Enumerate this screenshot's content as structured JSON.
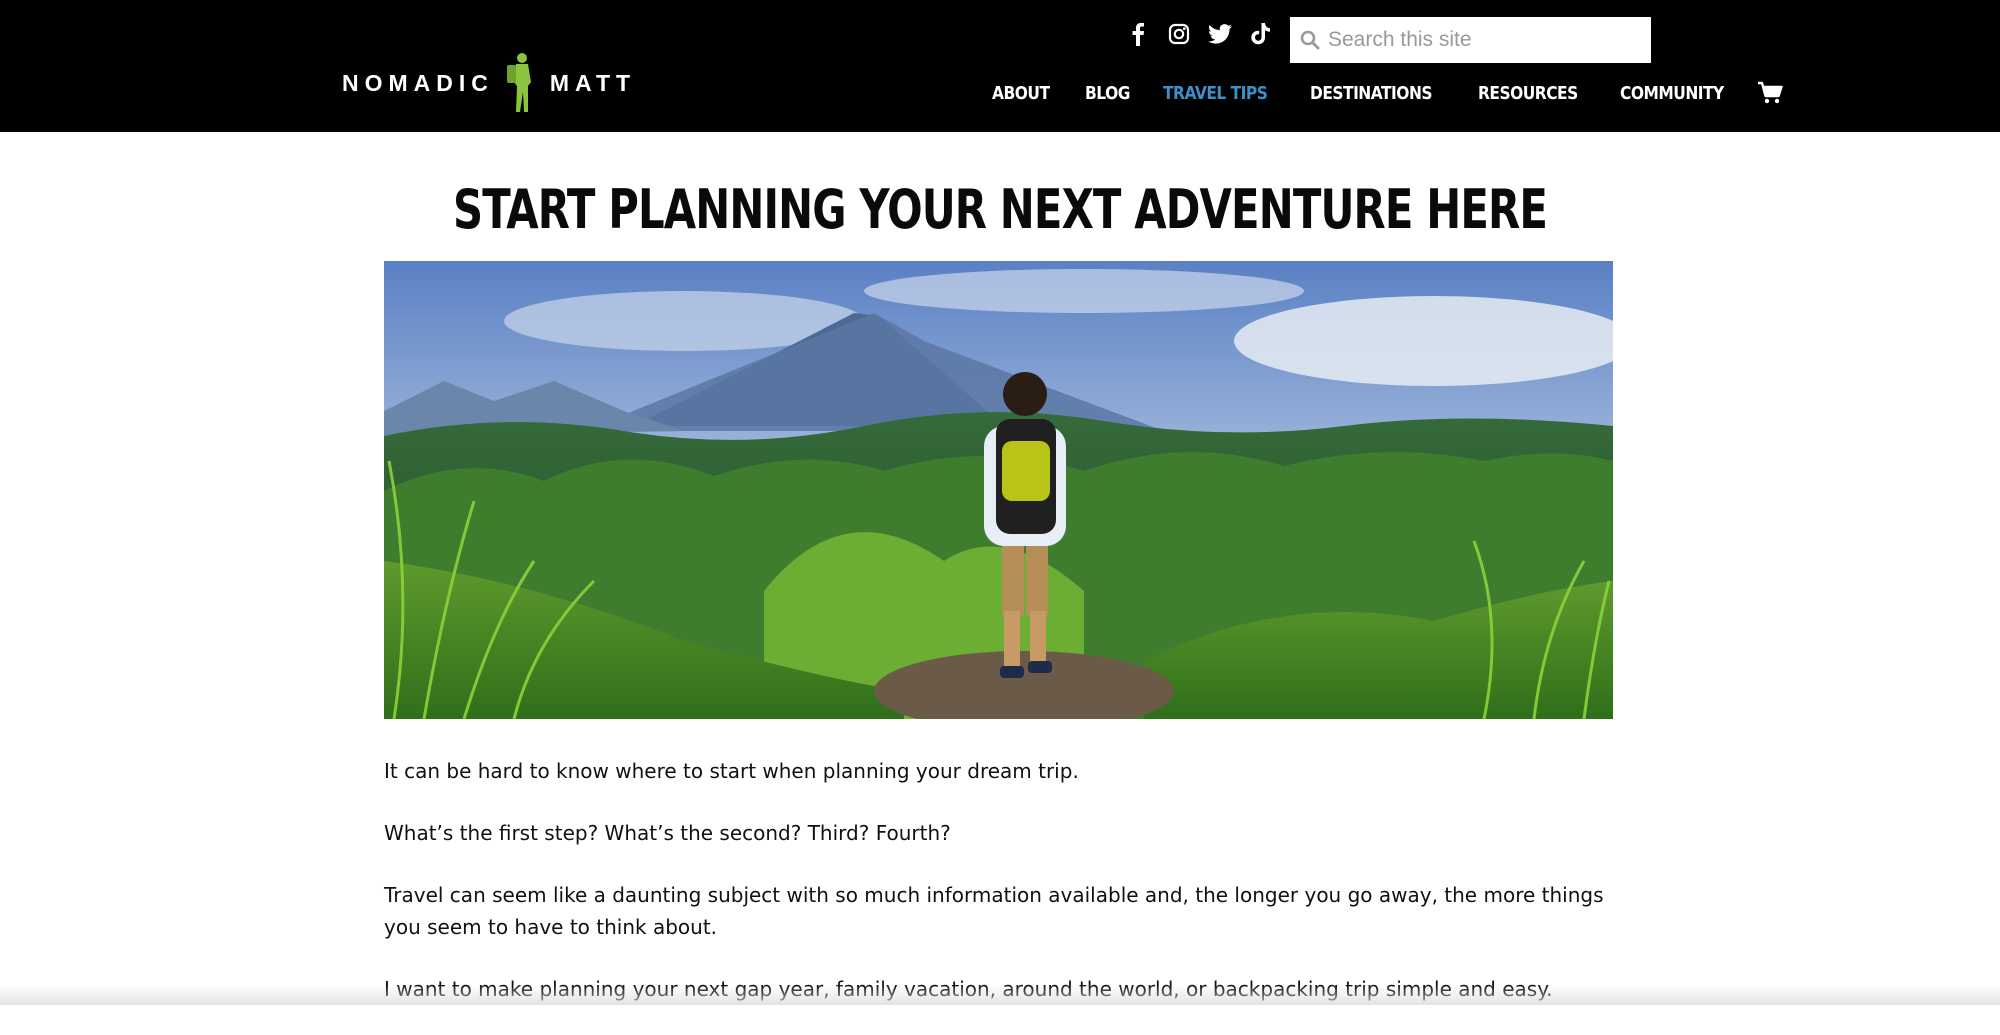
{
  "brand": {
    "logo_left": "NOMADIC",
    "logo_right": "MATT",
    "logo_figure_color": "#8bc53f"
  },
  "social": [
    {
      "name": "facebook-icon"
    },
    {
      "name": "instagram-icon"
    },
    {
      "name": "twitter-icon"
    },
    {
      "name": "tiktok-icon"
    }
  ],
  "search": {
    "placeholder": "Search this site",
    "value": ""
  },
  "nav": {
    "items": [
      {
        "label": "ABOUT",
        "active": false
      },
      {
        "label": "BLOG",
        "active": false
      },
      {
        "label": "TRAVEL TIPS",
        "active": true
      },
      {
        "label": "DESTINATIONS",
        "active": false
      },
      {
        "label": "RESOURCES",
        "active": false
      },
      {
        "label": "COMMUNITY",
        "active": false
      }
    ],
    "active_color": "#3c8fc9"
  },
  "main": {
    "headline": "START PLANNING YOUR NEXT ADVENTURE HERE",
    "hero_alt": "hiker-with-backpack-overlooking-green-hills-and-volcano",
    "paragraphs": [
      "It can be hard to know where to start when planning your dream trip.",
      "What’s the first step? What’s the second? Third? Fourth?",
      "Travel can seem like a daunting subject with so much information available and, the longer you go away, the more things you seem to have to think about.",
      "I want to make planning your next gap year, family vacation, around the world, or backpacking trip simple and easy."
    ]
  }
}
